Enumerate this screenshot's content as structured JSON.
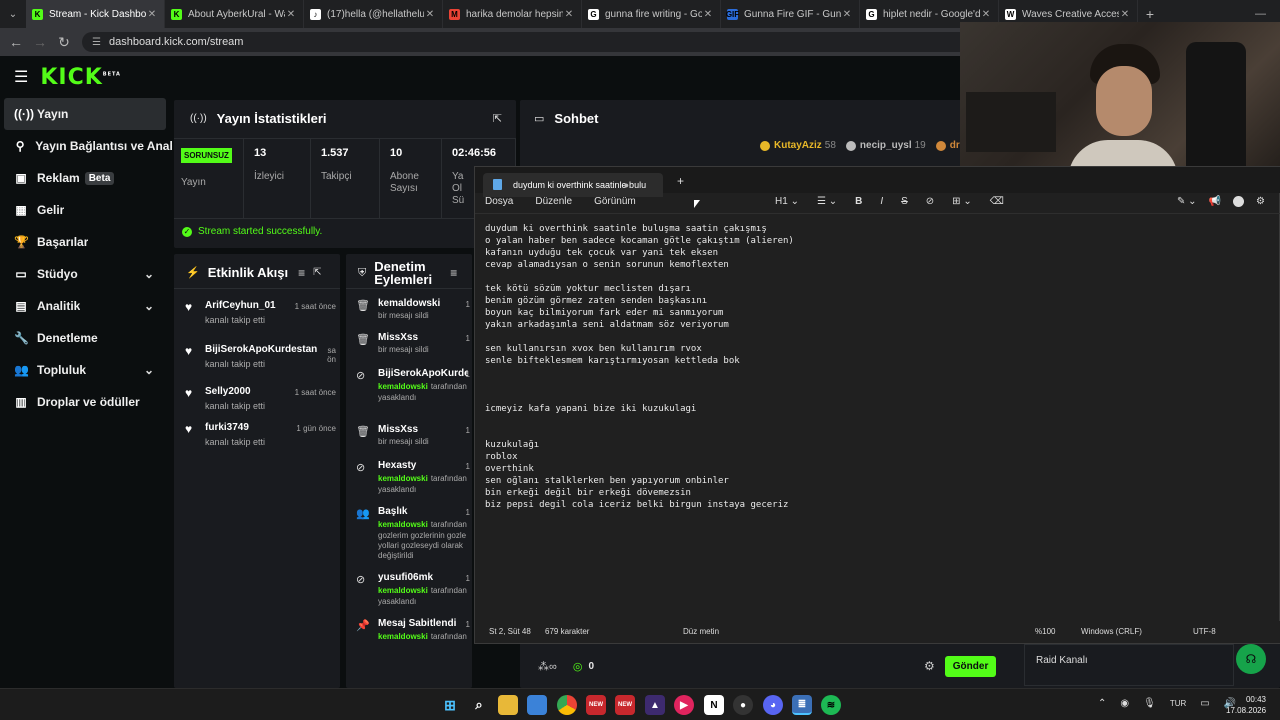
{
  "browser": {
    "tabs": [
      {
        "title": "Stream - Kick Dashboard",
        "color": "#53fc18",
        "fav": "K"
      },
      {
        "title": "About AyberkUral - Watc",
        "color": "#53fc18",
        "fav": "K"
      },
      {
        "title": "(17)hella (@hellatheluv) |",
        "color": "#ffffff",
        "fav": "♪"
      },
      {
        "title": "harika demolar hepsini d",
        "color": "#ea4335",
        "fav": "M"
      },
      {
        "title": "gunna fire writing - Goog",
        "color": "#ffffff",
        "fav": "G"
      },
      {
        "title": "Gunna Fire GIF - Gunna F",
        "color": "#2b6cd9",
        "fav": "GIF"
      },
      {
        "title": "hiplet nedir - Google'da A",
        "color": "#ffffff",
        "fav": "G"
      },
      {
        "title": "Waves Creative Access Pl",
        "color": "#ffffff",
        "fav": "W"
      }
    ],
    "url": "dashboard.kick.com/stream"
  },
  "kick": {
    "logo": "KICK",
    "logo_sup": "BETA",
    "sidebar": [
      {
        "label": "Yayın",
        "icon": "((·))",
        "active": true
      },
      {
        "label": "Yayın Bağlantısı ve Anahtar",
        "icon": "⚲"
      },
      {
        "label": "Reklam",
        "icon": "▣",
        "badge": "Beta"
      },
      {
        "label": "Gelir",
        "icon": "▦"
      },
      {
        "label": "Başarılar",
        "icon": "🏆"
      },
      {
        "label": "Stüdyo",
        "icon": "▭",
        "chevron": true
      },
      {
        "label": "Analitik",
        "icon": "▤",
        "chevron": true
      },
      {
        "label": "Denetleme",
        "icon": "🔧"
      },
      {
        "label": "Topluluk",
        "icon": "👥",
        "chevron": true
      },
      {
        "label": "Droplar ve ödüller",
        "icon": "▥"
      }
    ],
    "stats": {
      "title": "Yayın İstatistikleri",
      "status_badge": "SORUNSUZ",
      "status_label": "Yayın",
      "items": [
        {
          "value": "13",
          "label": "İzleyici"
        },
        {
          "value": "1.537",
          "label": "Takipçi"
        },
        {
          "value": "10",
          "label": "Abone Sayısı"
        },
        {
          "value": "02:46:56",
          "label": "Ya\nOl\nSü"
        }
      ],
      "success_msg": "Stream started successfully."
    },
    "chat": {
      "title": "Sohbet",
      "leaders": [
        {
          "name": "KutayAziz",
          "count": "58",
          "color": "#e8b828"
        },
        {
          "name": "necip_uysl",
          "count": "19",
          "color": "#bbbbbb"
        },
        {
          "name": "dr",
          "count": "",
          "color": "#d0883a"
        }
      ],
      "input_count": "0",
      "send_label": "Gönder",
      "raid_label": "Raid Kanalı"
    },
    "activity": {
      "title": "Etkinlik Akışı",
      "items": [
        {
          "name": "ArifCeyhun_01",
          "sub": "kanalı takip etti",
          "time": "1 saat önce"
        },
        {
          "name": "BijiSerokApoKurdestan21",
          "sub": "kanalı takip etti",
          "time": "sa\nön"
        },
        {
          "name": "Selly2000",
          "sub": "kanalı takip etti",
          "time": "1 saat önce"
        },
        {
          "name": "furki3749",
          "sub": "kanalı takip etti",
          "time": "1 gün önce"
        }
      ]
    },
    "moderation": {
      "title": "Denetim Eylemleri",
      "items": [
        {
          "icon": "trash-icon",
          "name": "kemaldowski",
          "line1": "bir mesajı sildi",
          "mod": "",
          "extra": ""
        },
        {
          "icon": "trash-icon",
          "name": "MissXss",
          "line1": "bir mesajı sildi",
          "mod": "",
          "extra": ""
        },
        {
          "icon": "ban-icon",
          "name": "BijiSerokApoKurdestan",
          "line1": "yasaklandı",
          "mod": "kemaldowski",
          "extra": "tarafından"
        },
        {
          "icon": "trash-icon",
          "name": "MissXss",
          "line1": "bir mesajı sildi",
          "mod": "",
          "extra": ""
        },
        {
          "icon": "ban-icon",
          "name": "Hexasty",
          "line1": "yasaklandı",
          "mod": "kemaldowski",
          "extra": "tarafından"
        },
        {
          "icon": "user-icon",
          "name": "Başlık",
          "line1": "gozlerim gozlerinin gozle yollari gozleseydi olarak değiştirildi",
          "mod": "kemaldowski",
          "extra": "tarafından"
        },
        {
          "icon": "ban-icon",
          "name": "yusufi06mk",
          "line1": "yasaklandı",
          "mod": "kemaldowski",
          "extra": "tarafından"
        },
        {
          "icon": "pin-icon",
          "name": "Mesaj Sabitlendi",
          "line1": "",
          "mod": "kemaldowski",
          "extra": "tarafından"
        }
      ],
      "time_stub": "1"
    }
  },
  "notepad": {
    "tab_title": "duydum ki overthink saatinle bulu",
    "menu": [
      "Dosya",
      "Düzenle",
      "Görünüm"
    ],
    "heading_select": "H1",
    "text": "duydum ki overthink saatinle buluşma saatin çakışmış\no yalan haber ben sadece kocaman götle çakıştım (alieren)\nkafanın uyduğu tek çocuk var yani tek eksen\ncevap alamadıysan o senin sorunun kemoflexten\n\ntek kötü sözüm yoktur meclisten dışarı\nbenim gözüm görmez zaten senden başkasını\nboyun kaç bilmiyorum fark eder mi sanmıyorum\nyakın arkadaşımla seni aldatmam söz veriyorum\n\nsen kullanırsın xvox ben kullanırım rvox\nsenle bifteklesmem karıştırmıyosan kettleda bok\n\n\n\nicmeyiz kafa yapani bize iki kuzukulagi\n\n\nkuzukulağı\nroblox\noverthink\nsen oğlanı stalklerken ben yapıyorum onbinler\nbin erkeği değil bir erkeği dövemezsin\nbiz pepsi degil cola iceriz belki birgun instaya geceriz",
    "status": {
      "position": "St 2, Süt 48",
      "chars": "679 karakter",
      "format": "Düz metin",
      "zoom": "%100",
      "eol": "Windows (CRLF)",
      "encoding": "UTF-8"
    }
  },
  "taskbar": {
    "lang": "TUR",
    "time": "00:43",
    "date": "17.08.2026"
  }
}
